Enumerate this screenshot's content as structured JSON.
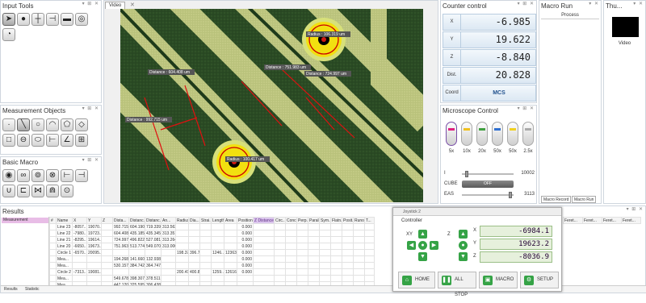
{
  "input_tools": {
    "title": "Input Tools"
  },
  "measurement_objects": {
    "title": "Measurement Objects"
  },
  "basic_macro": {
    "title": "Basic Macro"
  },
  "video": {
    "tab": "Video",
    "labels": {
      "r1": "Radius : 106.319 um",
      "r2": "Radius : 100.417 um",
      "d1": "Distance : 604.408 um",
      "d2": "Distance : 751.983 um",
      "d3": "Distance : 724.997 um",
      "d4": "Distance : 992.715 um"
    }
  },
  "counter": {
    "title": "Counter control",
    "x_label": "X",
    "x_value": "-6.985",
    "y_label": "Y",
    "y_value": "19.622",
    "z_label": "Z",
    "z_value": "-8.840",
    "dist_label": "Dist.",
    "dist_value": "20.828",
    "coord_label": "Coord",
    "coord_value": "MCS"
  },
  "microscope": {
    "title": "Microscope Control",
    "lenses": [
      "5x",
      "10x",
      "20x",
      "50x",
      "50x",
      "2.5x"
    ],
    "i_label": "I",
    "i_value": "10002",
    "cube_label": "CUBE",
    "cube_button": "OFF",
    "eas_label": "EAS",
    "eas_value": "3113"
  },
  "macro_run": {
    "title": "Macro Run",
    "header": "Process",
    "tab_record": "Macro Record",
    "tab_run": "Macro Run"
  },
  "thumb": {
    "title": "Thu...",
    "label": "Video"
  },
  "results": {
    "title": "Results",
    "sidebar_item": "Measurement",
    "columns": [
      "#",
      "Name",
      "X",
      "Y",
      "Z",
      "Dista...",
      "Distanc...",
      "Distanc...",
      "An...",
      "Radius",
      "Dia...",
      "Strai...",
      "Length",
      "Area",
      "Position",
      "Z Distance",
      "Circ...",
      "Conc...",
      "Perp...",
      "Parall...",
      "Sym...",
      "Flatn...",
      "Posit...",
      "Runout",
      "T..."
    ],
    "right_columns": [
      "Feret...",
      "Feret...",
      "Feret...",
      "Feret..."
    ],
    "rows": [
      [
        "",
        "Line 23",
        "-8057...",
        "19070...",
        "",
        "992.715",
        "604.190",
        "719.339",
        "313.563",
        "",
        "",
        "",
        "",
        "",
        "0.000"
      ],
      [
        "",
        "Line 22",
        "-7980...",
        "19723...",
        "",
        "604.408",
        "435.185",
        "435.345",
        "313.351",
        "",
        "",
        "",
        "",
        "",
        "0.000"
      ],
      [
        "",
        "Line 21",
        "-8295...",
        "19614...",
        "",
        "724.997",
        "496.822",
        "527.081",
        "313.264",
        "",
        "",
        "",
        "",
        "",
        "0.000"
      ],
      [
        "",
        "Line 20",
        "-6650...",
        "19673...",
        "",
        "751.963",
        "513.774",
        "549.070",
        "313.000",
        "",
        "",
        "",
        "",
        "",
        "0.000"
      ],
      [
        "",
        "Circle 1",
        "-6570...",
        "20095...",
        "",
        "",
        "",
        "",
        "",
        "198.379",
        "396.758",
        "",
        "1246....",
        "12363....",
        "0.000"
      ],
      [
        "",
        "Mea...",
        "",
        "",
        "",
        "194.268",
        "141.660",
        "132.938",
        "",
        "",
        "",
        "",
        "",
        "",
        "0.000"
      ],
      [
        "",
        "Mea...",
        "",
        "",
        "",
        "530.157",
        "384.742",
        "364.747",
        "",
        "",
        "",
        "",
        "",
        "",
        "0.000"
      ],
      [
        "",
        "Circle 2",
        "-7313...",
        "19081....",
        "",
        "",
        "",
        "",
        "",
        "200.412",
        "400.825",
        "",
        "1259....",
        "12616....",
        "0.000"
      ],
      [
        "",
        "Mea...",
        "",
        "",
        "",
        "549.678",
        "398.307",
        "378.511",
        "",
        "",
        "",
        "",
        "",
        "",
        ""
      ],
      [
        "",
        "Mea...",
        "",
        "",
        "",
        "447.120",
        "325.595",
        "306.438",
        "",
        "",
        "",
        "",
        "",
        "",
        ""
      ]
    ],
    "tab_results": "Results",
    "tab_statistic": "Statistic"
  },
  "joystick": {
    "title": "Joystick 2",
    "controller": "Controller",
    "xy_label": "XY",
    "z_label": "Z",
    "x_label": "X",
    "x_value": "-6984.1",
    "y_label": "Y",
    "y_value": "19623.2",
    "z2_label": "Z",
    "z_value": "-8036.9",
    "home": "HOME",
    "all_stop": "ALL STOP",
    "macro": "MACRO",
    "setup": "SETUP"
  }
}
